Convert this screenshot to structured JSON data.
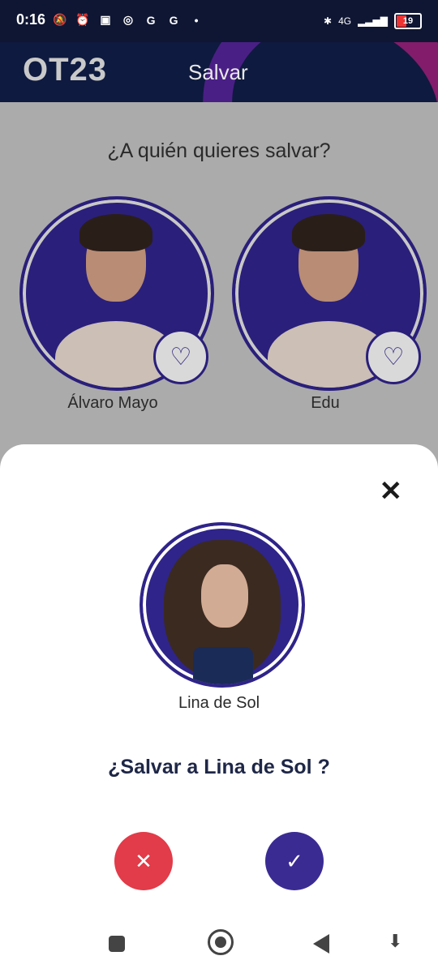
{
  "status_bar": {
    "time": "0:16",
    "left_icons": [
      "mute-alarm-icon",
      "alarm-icon",
      "nfc-icon",
      "whatsapp-icon",
      "google-icon",
      "google-icon",
      "dot-icon"
    ],
    "network_label": "4G",
    "battery_level": "19",
    "battery_color": "#e33333"
  },
  "header": {
    "logo_text": "OT23",
    "title": "Salvar",
    "background_color": "#0e1a3f"
  },
  "main": {
    "question": "¿A quién quieres salvar?",
    "candidates": [
      {
        "name": "Álvaro Mayo",
        "action_icon": "heart-icon"
      },
      {
        "name": "Edu",
        "action_icon": "heart-icon"
      }
    ],
    "accent_color": "#2a1f7a"
  },
  "sheet": {
    "close_label": "✕",
    "candidate_name": "Lina de Sol",
    "confirm_question": "¿Salvar a Lina de Sol ?",
    "reject_label": "✕",
    "accept_label": "✓",
    "reject_color": "#e23b49",
    "accept_color": "#3a2b93"
  },
  "nav": {
    "icons": [
      "recents-icon",
      "home-icon",
      "back-icon",
      "assistant-icon"
    ]
  }
}
